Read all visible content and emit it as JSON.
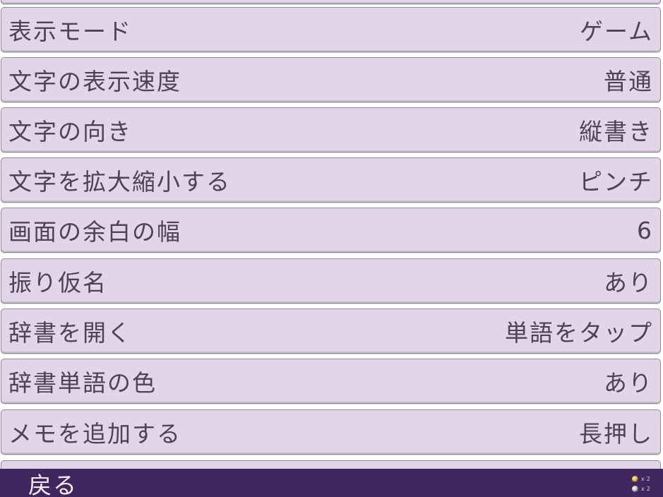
{
  "settings": [
    {
      "label": "表示モード",
      "value": "ゲーム"
    },
    {
      "label": "文字の表示速度",
      "value": "普通"
    },
    {
      "label": "文字の向き",
      "value": "縦書き"
    },
    {
      "label": "文字を拡大縮小する",
      "value": "ピンチ"
    },
    {
      "label": "画面の余白の幅",
      "value": "6"
    },
    {
      "label": "振り仮名",
      "value": "あり"
    },
    {
      "label": "辞書を開く",
      "value": "単語をタップ"
    },
    {
      "label": "辞書単語の色",
      "value": "あり"
    },
    {
      "label": "メモを追加する",
      "value": "長押し"
    }
  ],
  "bottom_bar": {
    "back_label": "戻る",
    "counters": [
      {
        "icon": "gold-coin-icon",
        "x": "x",
        "count": "2"
      },
      {
        "icon": "silver-coin-icon",
        "x": "x",
        "count": "2"
      }
    ]
  },
  "colors": {
    "row_background": "#e2d5e9",
    "row_text": "#4e4255",
    "bottom_bar": "#42275f",
    "bottom_bar_text": "#f4eef8"
  }
}
